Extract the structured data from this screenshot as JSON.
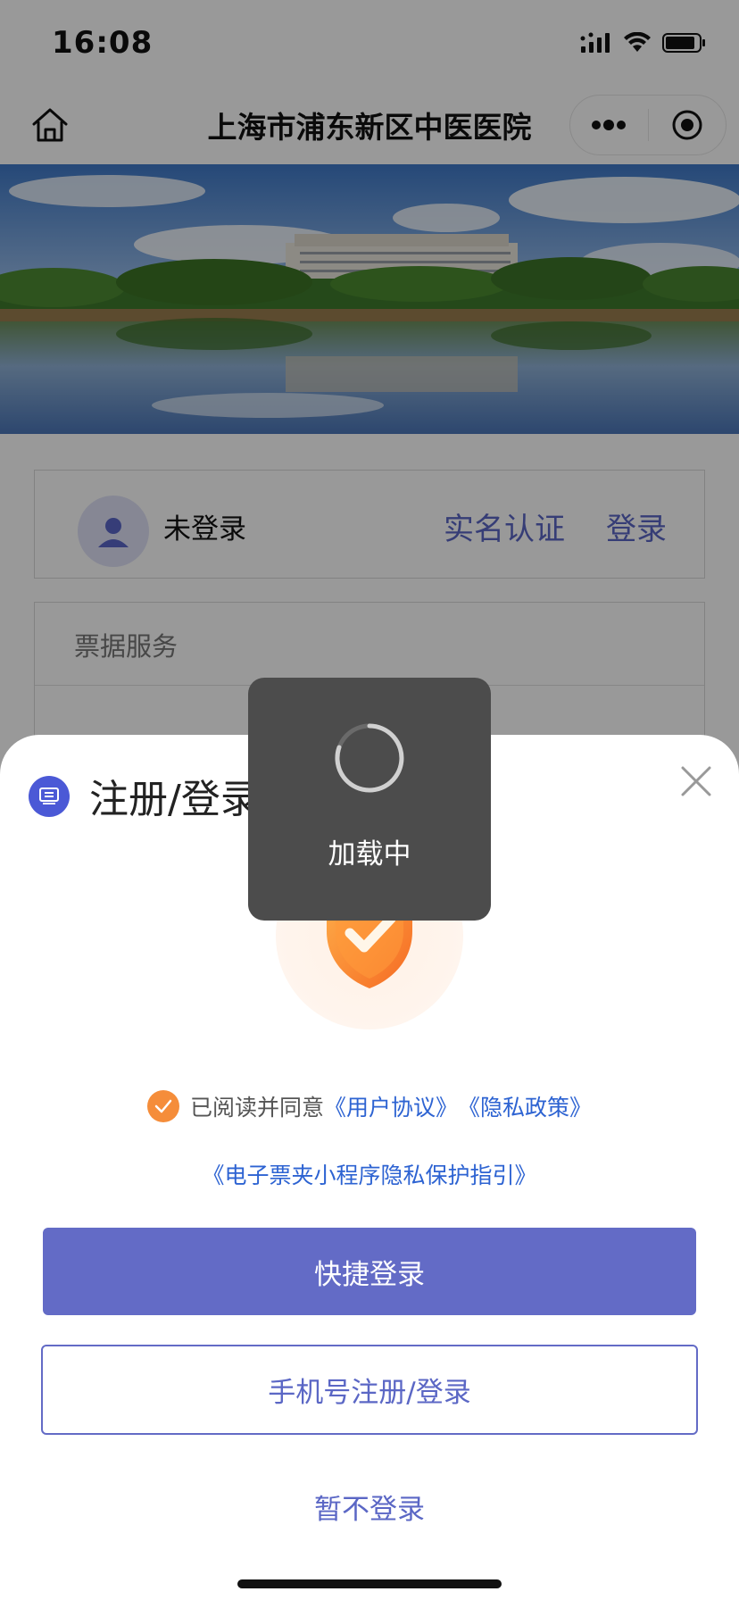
{
  "status_bar": {
    "time": "16:08"
  },
  "nav": {
    "title": "上海市浦东新区中医医院",
    "home_icon": "home-icon",
    "more_icon": "more-dots-icon",
    "target_icon": "record-target-icon"
  },
  "user_card": {
    "status": "未登录",
    "verify_label": "实名认证",
    "login_label": "登录"
  },
  "service_card": {
    "title": "票据服务"
  },
  "sheet": {
    "title": "注册/登录",
    "agree_prefix": "已阅读并同意",
    "user_agreement": "《用户协议》",
    "privacy_policy": "《隐私政策》",
    "privacy_guide": "《电子票夹小程序隐私保护指引》",
    "quick_login": "快捷登录",
    "phone_login": "手机号注册/登录",
    "skip": "暂不登录"
  },
  "toast": {
    "text": "加载中"
  },
  "colors": {
    "accent": "#636bc6",
    "link": "#2d63d2",
    "check": "#f58d3a",
    "toast_bg": "#4c4c4c"
  }
}
